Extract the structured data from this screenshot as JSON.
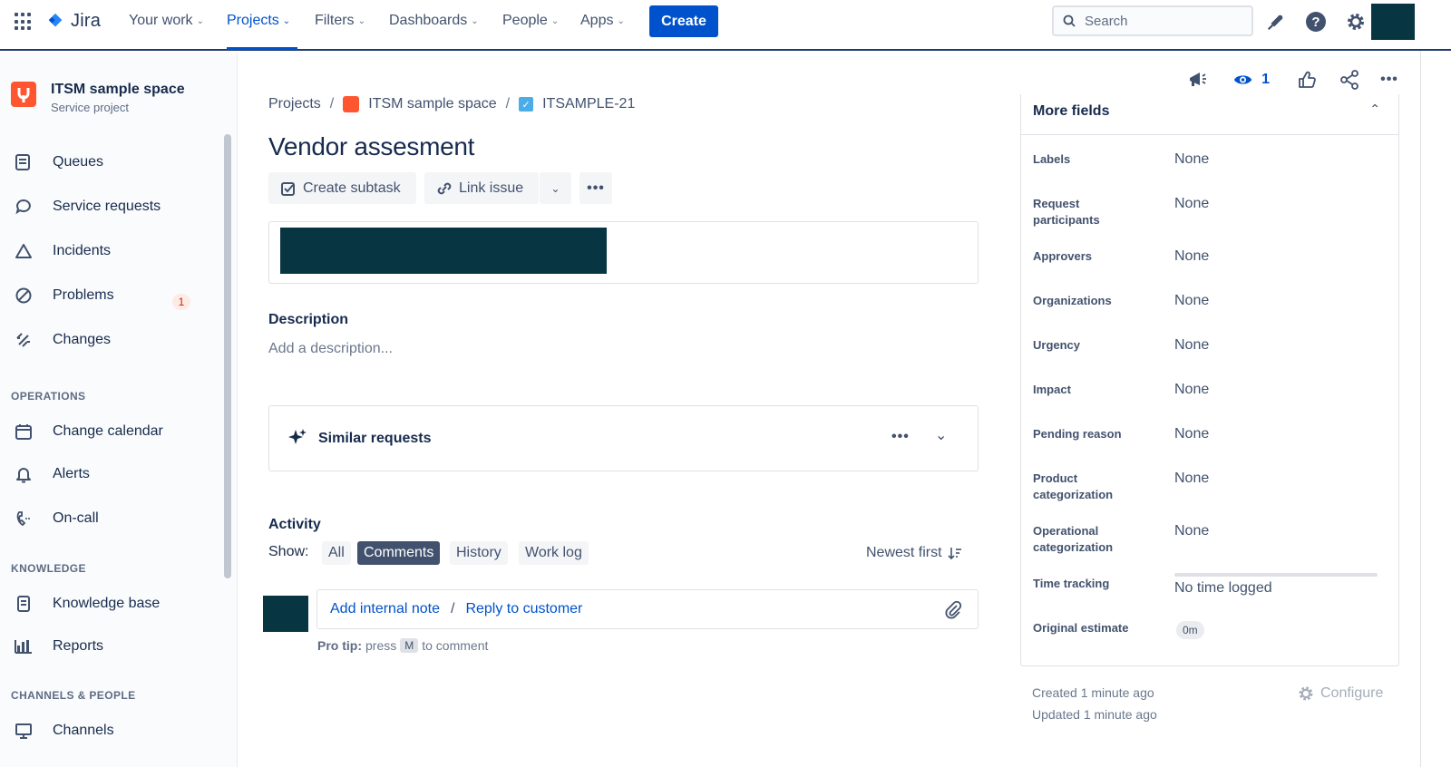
{
  "topnav": {
    "logo_text": "Jira",
    "items": [
      {
        "label": "Your work"
      },
      {
        "label": "Projects"
      },
      {
        "label": "Filters"
      },
      {
        "label": "Dashboards"
      },
      {
        "label": "People"
      },
      {
        "label": "Apps"
      }
    ],
    "create_label": "Create",
    "search_placeholder": "Search"
  },
  "sidebar": {
    "project_name": "ITSM sample space",
    "project_type": "Service project",
    "items": [
      {
        "label": "Queues",
        "icon": "queues-icon"
      },
      {
        "label": "Service requests",
        "icon": "chat-icon"
      },
      {
        "label": "Incidents",
        "icon": "warning-icon",
        "badge": "1"
      },
      {
        "label": "Problems",
        "icon": "problem-icon"
      },
      {
        "label": "Changes",
        "icon": "changes-icon"
      }
    ],
    "operations_heading": "OPERATIONS",
    "operations": [
      {
        "label": "Change calendar",
        "icon": "calendar-icon"
      },
      {
        "label": "Alerts",
        "icon": "bell-icon"
      },
      {
        "label": "On-call",
        "icon": "phone-icon"
      }
    ],
    "knowledge_heading": "KNOWLEDGE",
    "knowledge": [
      {
        "label": "Knowledge base",
        "icon": "book-icon"
      },
      {
        "label": "Reports",
        "icon": "chart-icon"
      }
    ],
    "channels_heading": "CHANNELS & PEOPLE",
    "channels": [
      {
        "label": "Channels",
        "icon": "monitor-icon"
      }
    ]
  },
  "issue": {
    "breadcrumb": {
      "projects": "Projects",
      "project": "ITSM sample space",
      "key": "ITSAMPLE-21"
    },
    "title": "Vendor assesment",
    "create_subtask": "Create subtask",
    "link_issue": "Link issue",
    "description_label": "Description",
    "description_placeholder": "Add a description...",
    "similar_requests": "Similar requests",
    "activity_label": "Activity",
    "show_label": "Show:",
    "filters": [
      "All",
      "Comments",
      "History",
      "Work log"
    ],
    "selected_filter": "Comments",
    "sort_label": "Newest first",
    "add_internal_note": "Add internal note",
    "separator": "/",
    "reply_to_customer": "Reply to customer",
    "pro_tip_bold": "Pro tip:",
    "pro_tip_press": "press",
    "pro_tip_key": "M",
    "pro_tip_rest": "to comment"
  },
  "right": {
    "watch_count": "1",
    "more_fields": "More fields",
    "fields": [
      {
        "label": "Labels",
        "value": "None"
      },
      {
        "label": "Request participants",
        "value": "None"
      },
      {
        "label": "Approvers",
        "value": "None"
      },
      {
        "label": "Organizations",
        "value": "None"
      },
      {
        "label": "Urgency",
        "value": "None"
      },
      {
        "label": "Impact",
        "value": "None"
      },
      {
        "label": "Pending reason",
        "value": "None"
      },
      {
        "label": "Product categorization",
        "value": "None"
      },
      {
        "label": "Operational categorization",
        "value": "None"
      },
      {
        "label": "Time tracking",
        "value": "No time logged"
      },
      {
        "label": "Original estimate",
        "value": "0m"
      }
    ],
    "created": "Created 1 minute ago",
    "updated": "Updated 1 minute ago",
    "configure": "Configure"
  },
  "colors": {
    "accent": "#0052cc",
    "redacted": "#073642",
    "project_icon": "#ff5630"
  }
}
